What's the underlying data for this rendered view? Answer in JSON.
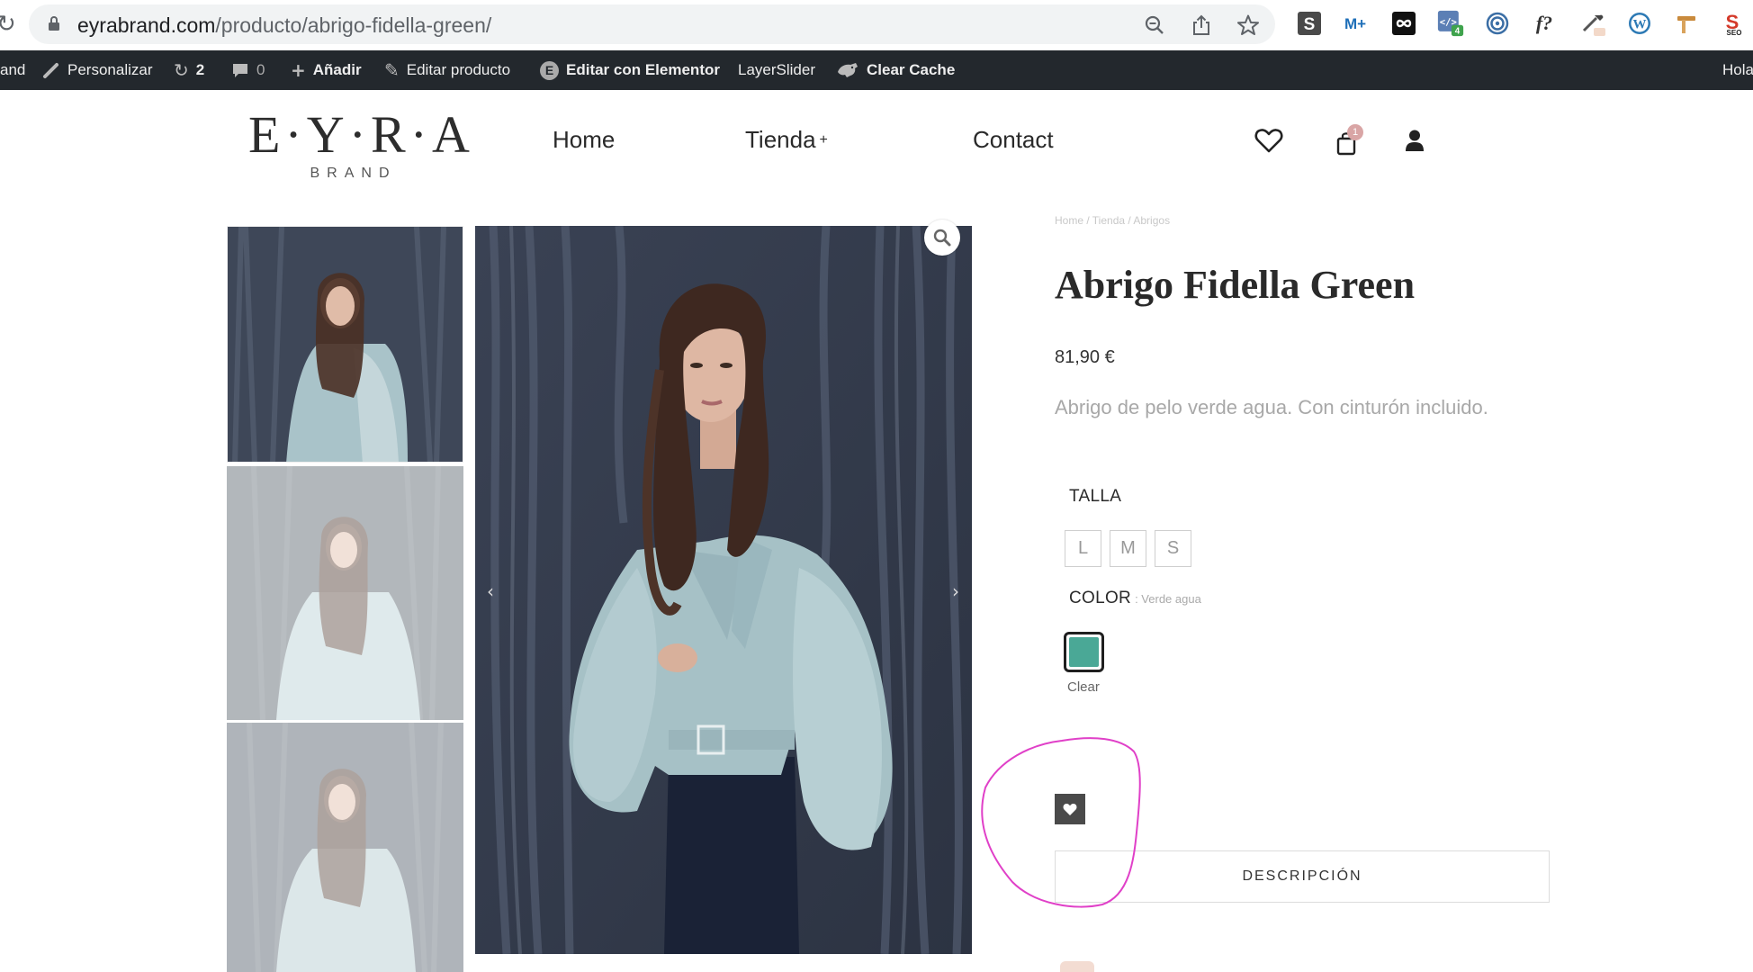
{
  "browser": {
    "url_domain": "eyrabrand.com",
    "url_path": "/producto/abrigo-fidella-green/",
    "extensions": [
      {
        "icon": "sitemap-s-icon",
        "label": "S"
      },
      {
        "icon": "movistar-plus-icon",
        "label": "M+"
      },
      {
        "icon": "infinity-icon",
        "label": "∞"
      },
      {
        "icon": "code-inspector-icon",
        "badge": "4"
      },
      {
        "icon": "target-icon"
      },
      {
        "icon": "font-identifier-icon",
        "label": "f?"
      },
      {
        "icon": "eyedropper-icon"
      },
      {
        "icon": "wordpress-icon",
        "label": "W"
      },
      {
        "icon": "hammer-icon"
      },
      {
        "icon": "seo-icon",
        "label": "S",
        "sublabel": "SEO"
      }
    ]
  },
  "adminbar": {
    "site_fragment": "and",
    "customize": "Personalizar",
    "updates_count": "2",
    "comments_count": "0",
    "add_new": "Añadir",
    "edit_product": "Editar producto",
    "edit_elementor": "Editar con Elementor",
    "layerslider": "LayerSlider",
    "clear_cache": "Clear Cache",
    "greeting": "Hola"
  },
  "header": {
    "logo_main": "E·Y·R·A",
    "logo_sub": "BRAND",
    "nav": {
      "home": "Home",
      "shop": "Tienda",
      "shop_plus": "+",
      "contact": "Contact"
    },
    "cart_count": "1"
  },
  "product": {
    "breadcrumb": "Home / Tienda / Abrigos",
    "title": "Abrigo Fidella Green",
    "price": "81,90 €",
    "short_description": "Abrigo de pelo verde agua. Con cinturón incluido.",
    "size_label": "TALLA",
    "sizes": [
      "L",
      "M",
      "S"
    ],
    "color_label": "COLOR",
    "color_selected": ": Verde agua",
    "color_swatch": "#4aa896",
    "clear_label": "Clear",
    "description_tab": "DESCRIPCIÓN",
    "annotation_color": "#e040c8"
  }
}
